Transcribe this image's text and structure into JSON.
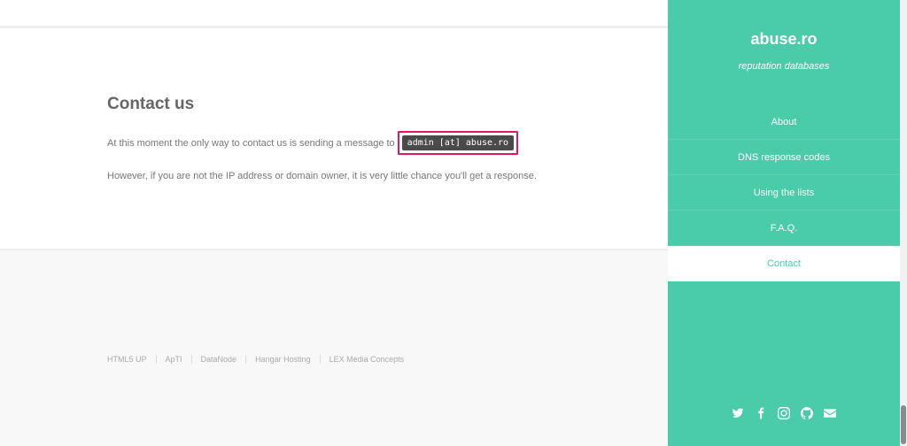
{
  "main": {
    "heading": "Contact us",
    "para1": "At this moment the only way to contact us is sending a message to",
    "email": "admin [at] abuse.ro",
    "para2": "However, if you are not the IP address or domain owner, it is very little chance you'll get a response."
  },
  "footer": {
    "links": [
      "HTML5 UP",
      "ApTI",
      "DataNode",
      "Hangar Hosting",
      "LEX Media Concepts"
    ]
  },
  "sidebar": {
    "title": "abuse.ro",
    "tagline": "reputation databases",
    "nav": [
      {
        "label": "About",
        "active": false
      },
      {
        "label": "DNS response codes",
        "active": false
      },
      {
        "label": "Using the lists",
        "active": false
      },
      {
        "label": "F.A.Q.",
        "active": false
      },
      {
        "label": "Contact",
        "active": true
      }
    ],
    "social": [
      "twitter-icon",
      "facebook-icon",
      "instagram-icon",
      "github-icon",
      "envelope-icon"
    ]
  },
  "colors": {
    "accent": "#4acba9",
    "highlight": "#e5175c"
  }
}
